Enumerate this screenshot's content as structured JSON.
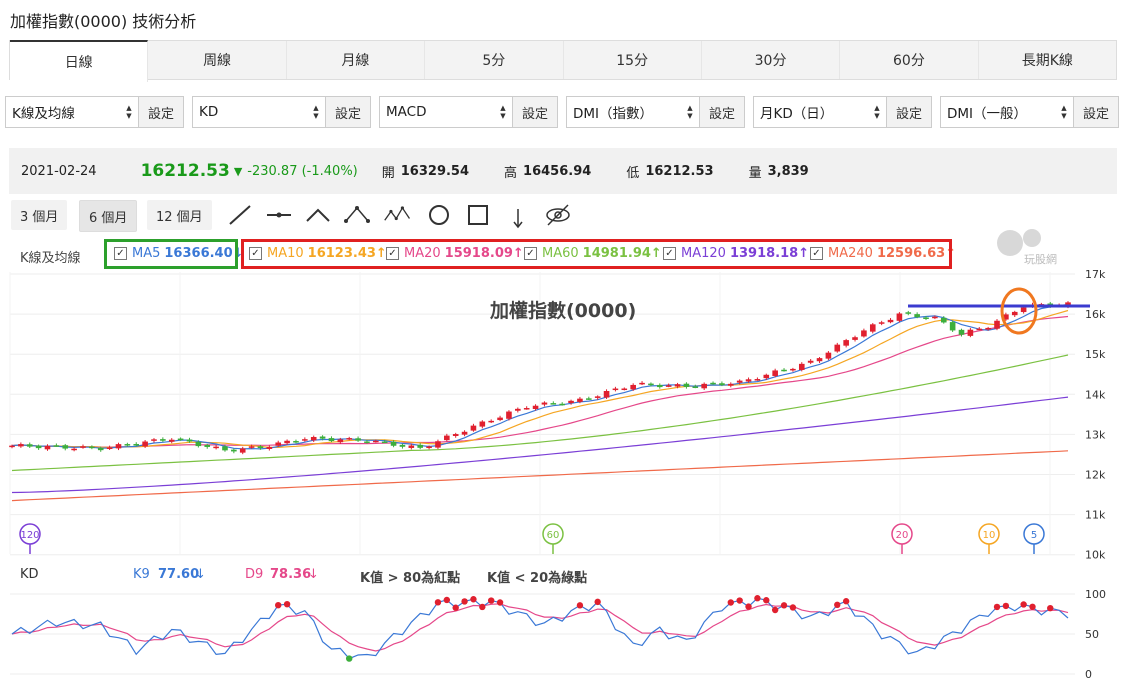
{
  "page": {
    "title": "加權指數(0000) 技術分析",
    "watermark": "玩股網"
  },
  "tabs": [
    "日線",
    "周線",
    "月線",
    "5分",
    "15分",
    "30分",
    "60分",
    "長期K線"
  ],
  "active_tab": "日線",
  "selectors": [
    {
      "value": "K線及均線",
      "button": "設定"
    },
    {
      "value": "KD",
      "button": "設定"
    },
    {
      "value": "MACD",
      "button": "設定"
    },
    {
      "value": "DMI（指數）",
      "button": "設定"
    },
    {
      "value": "月KD（日）",
      "button": "設定"
    },
    {
      "value": "DMI（一般）",
      "button": "設定"
    }
  ],
  "quote": {
    "date": "2021-02-24",
    "price": "16212.53",
    "arrow": "▼",
    "change": "-230.87 (-1.40%)",
    "open_label": "開",
    "open": "16329.54",
    "high_label": "高",
    "high": "16456.94",
    "low_label": "低",
    "low": "16212.53",
    "vol_label": "量",
    "vol": "3,839"
  },
  "ranges": [
    "3 個月",
    "6 個月",
    "12 個月"
  ],
  "active_range": "6 個月",
  "legend": {
    "label": "K線及均線",
    "items": [
      {
        "name": "MA5",
        "value": "16366.40",
        "dir": "↓",
        "color": "#3a78d6"
      },
      {
        "name": "MA10",
        "value": "16123.43",
        "dir": "↑",
        "color": "#f5a623"
      },
      {
        "name": "MA20",
        "value": "15918.09",
        "dir": "↑",
        "color": "#e5488a"
      },
      {
        "name": "MA60",
        "value": "14981.94",
        "dir": "↑",
        "color": "#7bc142"
      },
      {
        "name": "MA120",
        "value": "13918.18",
        "dir": "↑",
        "color": "#7b3fd6"
      },
      {
        "name": "MA240",
        "value": "12596.63",
        "dir": "↑",
        "color": "#f06a4a"
      }
    ]
  },
  "chart": {
    "title": "加權指數(0000)",
    "y_labels": [
      "17k",
      "16k",
      "15k",
      "14k",
      "13k",
      "12k",
      "11k",
      "10k"
    ],
    "markers": [
      {
        "label": "120",
        "color": "#7b3fd6"
      },
      {
        "label": "60",
        "color": "#7bc142"
      },
      {
        "label": "20",
        "color": "#e5488a"
      },
      {
        "label": "10",
        "color": "#f5a623"
      },
      {
        "label": "5",
        "color": "#3a78d6"
      }
    ]
  },
  "kd": {
    "label": "KD",
    "k_label": "K9",
    "k_value": "77.60",
    "k_dir": "↓",
    "d_label": "D9",
    "d_value": "78.36",
    "d_dir": "↓",
    "note1": "K值 > 80為紅點",
    "note2": "K值 < 20為綠點",
    "y_labels": [
      "100",
      "50",
      "0"
    ]
  },
  "colors": {
    "up": "#e0202f",
    "down": "#3cae3c",
    "highlight_green": "#2ca02c",
    "highlight_red": "#e02020",
    "blue_line": "#3b3bcf",
    "orange_circle": "#f07820"
  }
}
